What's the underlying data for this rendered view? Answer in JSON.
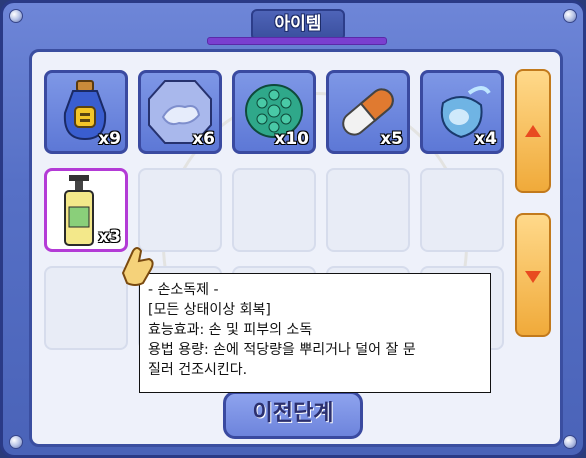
{
  "window": {
    "title": "아이템"
  },
  "inventory": {
    "items": [
      {
        "icon": "potion-bottle-icon",
        "count": "x9"
      },
      {
        "icon": "crystal-hand-icon",
        "count": "x6"
      },
      {
        "icon": "turtle-shell-icon",
        "count": "x10"
      },
      {
        "icon": "capsule-pill-icon",
        "count": "x5"
      },
      {
        "icon": "blue-pouch-icon",
        "count": "x4"
      },
      {
        "icon": "hand-sanitizer-icon",
        "count": "x3"
      }
    ]
  },
  "tooltip": {
    "name": "- 손소독제 -",
    "effect_tag": "[모든 상태이상 회복]",
    "line1": "효능효과: 손 및 피부의 소독",
    "line2": "용법 용량: 손에 적당량을 뿌리거나 덜어 잘 문",
    "line3": "질러 건조시킨다."
  },
  "buttons": {
    "prev": "이전단계"
  },
  "colors": {
    "frame": "#5670c6",
    "selected_border": "#b33bd6",
    "scroll": "#f0aa3a"
  }
}
